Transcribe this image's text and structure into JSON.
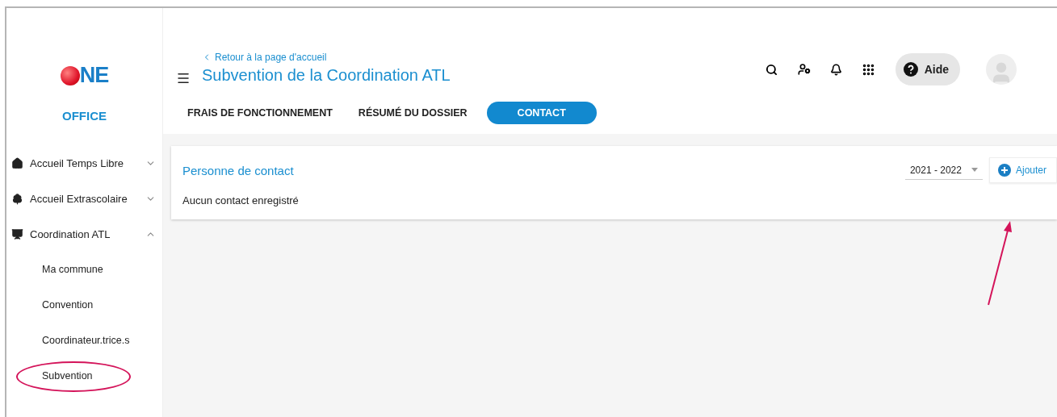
{
  "logo": {
    "text": "NE",
    "caption": "OFFICE"
  },
  "sidebar": {
    "items": [
      {
        "label": "Accueil Temps Libre",
        "kind": "home",
        "expanded": false
      },
      {
        "label": "Accueil Extrascolaire",
        "kind": "tree",
        "expanded": false
      },
      {
        "label": "Coordination ATL",
        "kind": "board",
        "expanded": true,
        "children": [
          {
            "label": "Ma commune",
            "circled": false
          },
          {
            "label": "Convention",
            "circled": false
          },
          {
            "label": "Coordinateur.trice.s",
            "circled": false
          },
          {
            "label": "Subvention",
            "circled": true
          }
        ]
      }
    ]
  },
  "header": {
    "back_link": "Retour à la page d'accueil",
    "title": "Subvention de la Coordination ATL",
    "help_button": "Aide"
  },
  "tabs": [
    {
      "label": "FRAIS DE FONCTIONNEMENT",
      "selected": false
    },
    {
      "label": "RÉSUMÉ DU DOSSIER",
      "selected": false
    },
    {
      "label": "CONTACT",
      "selected": true
    }
  ],
  "card": {
    "title": "Personne de contact",
    "year_select": "2021 - 2022",
    "add_button": "Ajouter",
    "add_button_arrow": true,
    "empty_message": "Aucun contact enregistré"
  }
}
